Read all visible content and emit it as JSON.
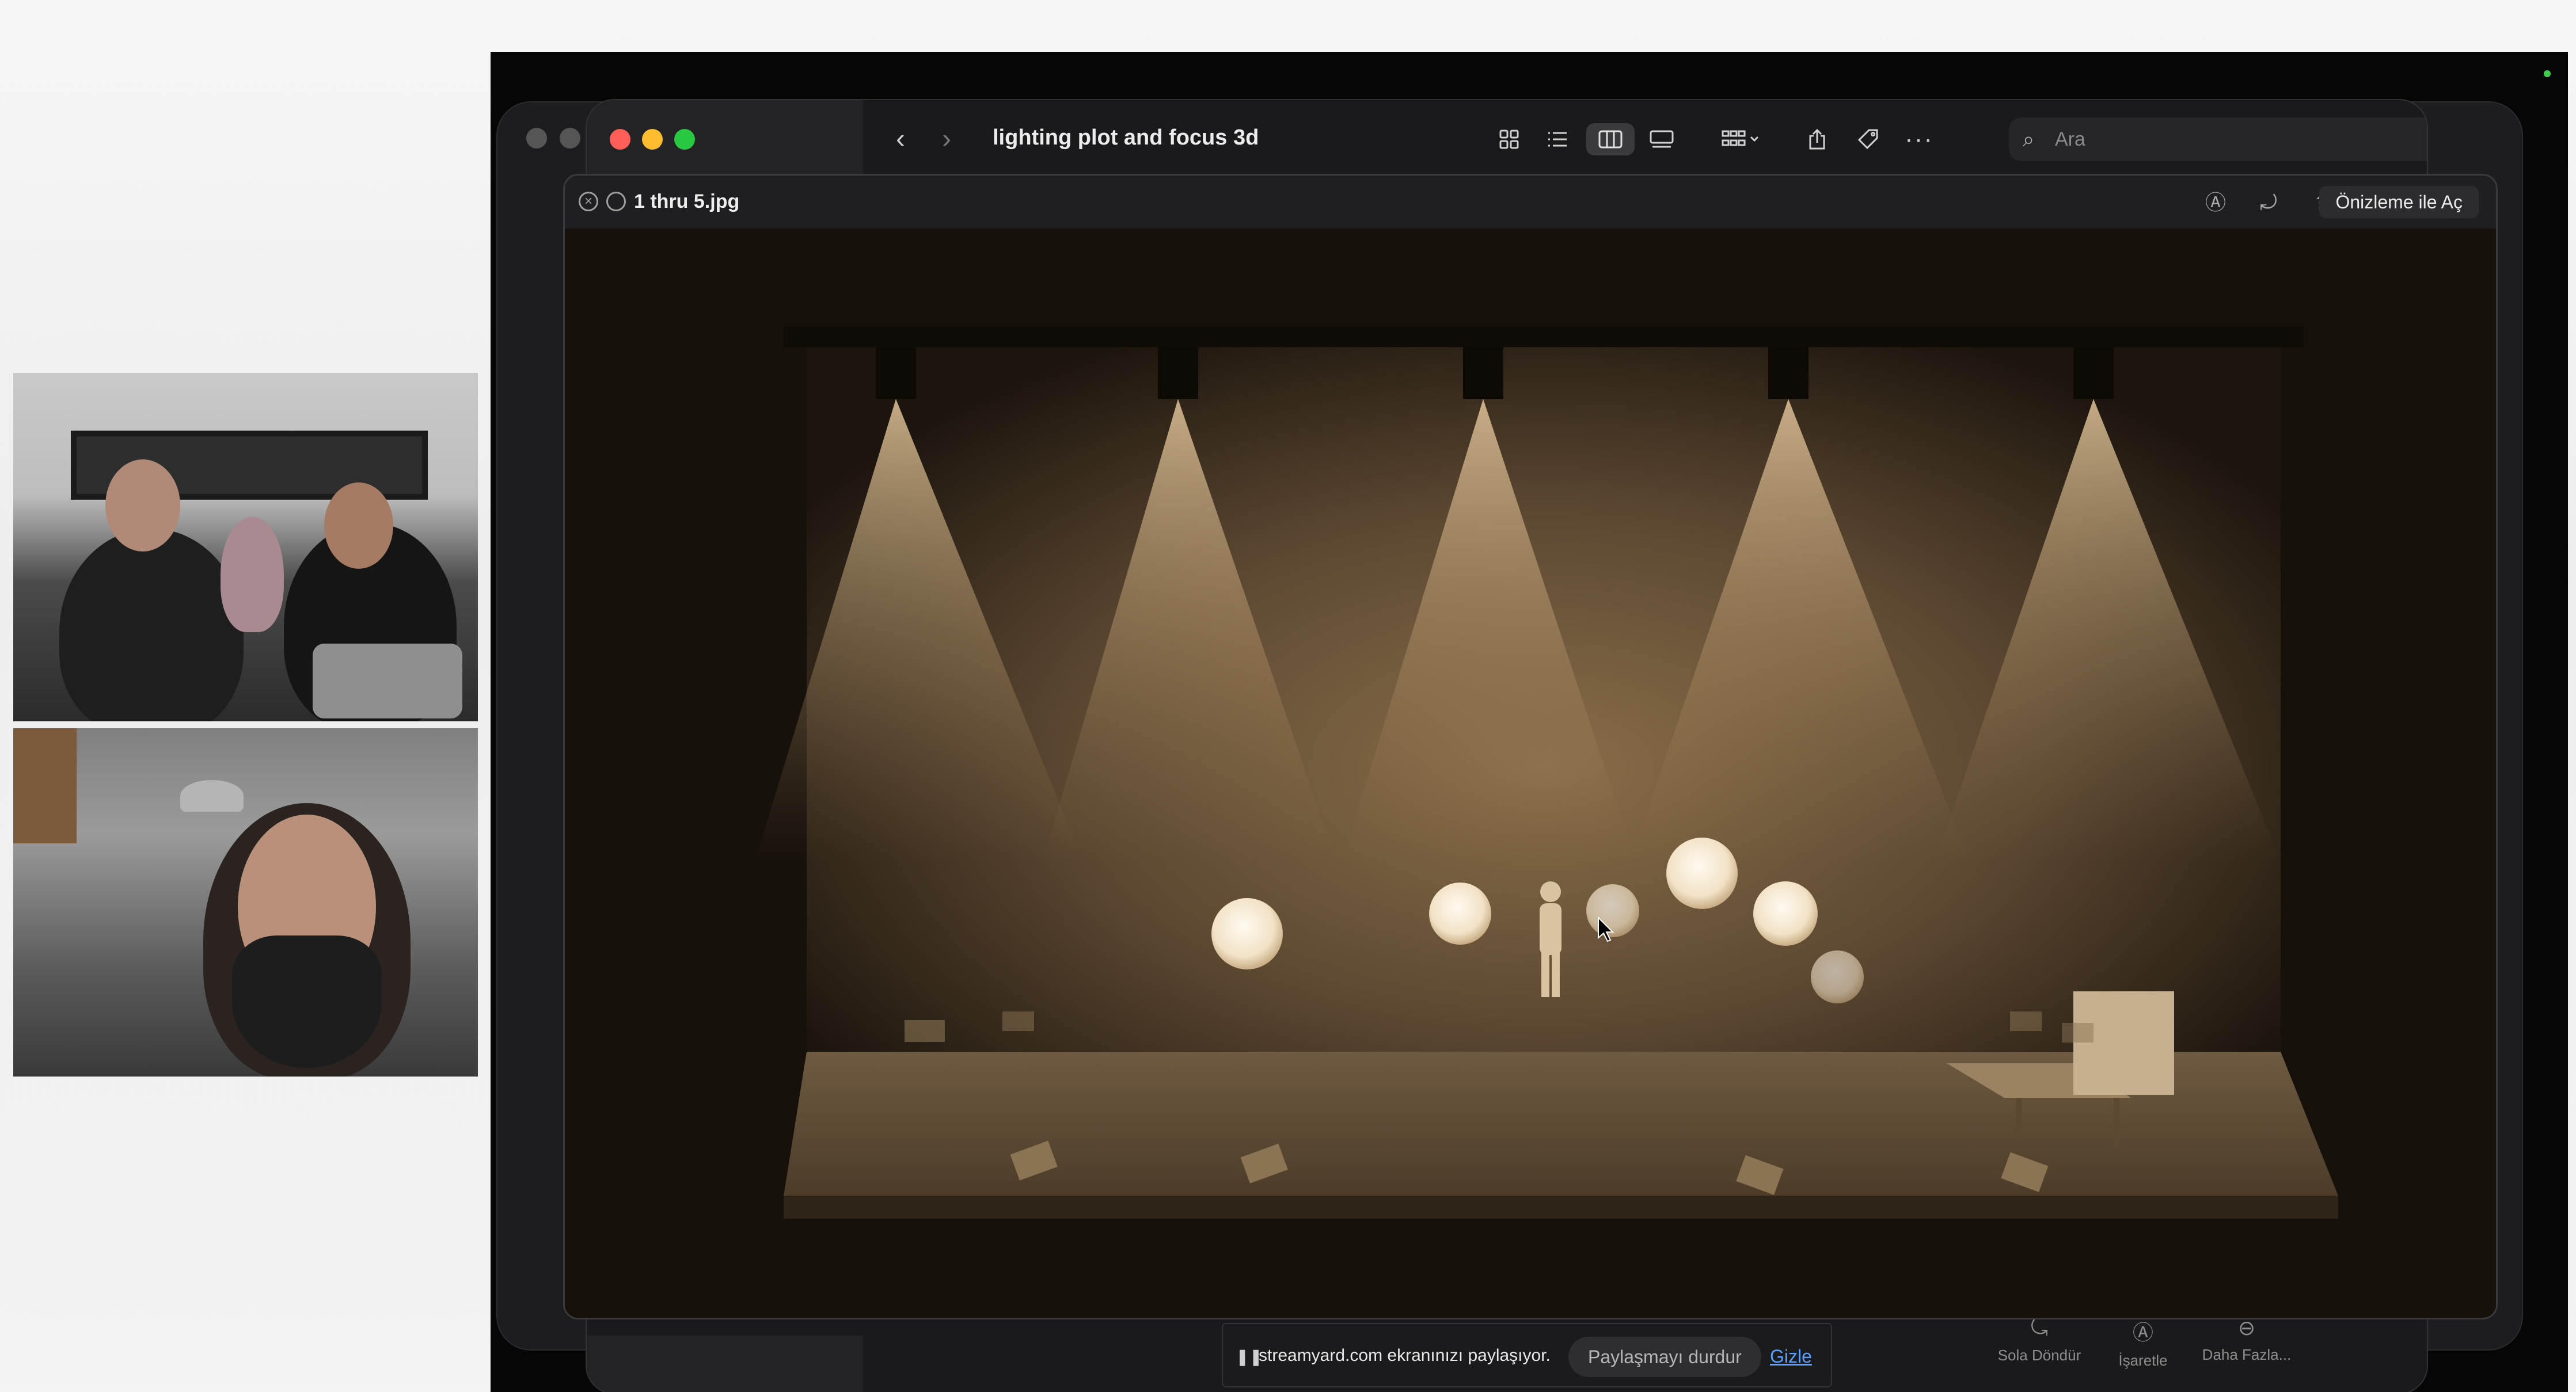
{
  "finder": {
    "title": "lighting plot and  focus 3d",
    "back_icon": "‹",
    "forward_icon": "›",
    "search_placeholder": "Ara"
  },
  "toolbar_icons": [
    "icon-view-icon",
    "list-view-icon",
    "column-view-icon",
    "gallery-view-icon",
    "group-icon",
    "share-icon",
    "tag-icon",
    "more-icon"
  ],
  "quicklook": {
    "filename": "1 thru 5.jpg",
    "open_with_label": "Önizleme ile Aç"
  },
  "share_bar": {
    "message": "streamyard.com ekranınızı paylaşıyor.",
    "stop_label": "Paylaşmayı durdur",
    "hide_label": "Gizle"
  },
  "bottom_tools": {
    "rotate_label": "Sola Döndür",
    "markup_label": "İşaretle",
    "more_label": "Daha Fazla..."
  },
  "colors": {
    "close": "#ff5f57",
    "minimize": "#febc2e",
    "maximize": "#28c840",
    "link": "#5aa2ff"
  }
}
